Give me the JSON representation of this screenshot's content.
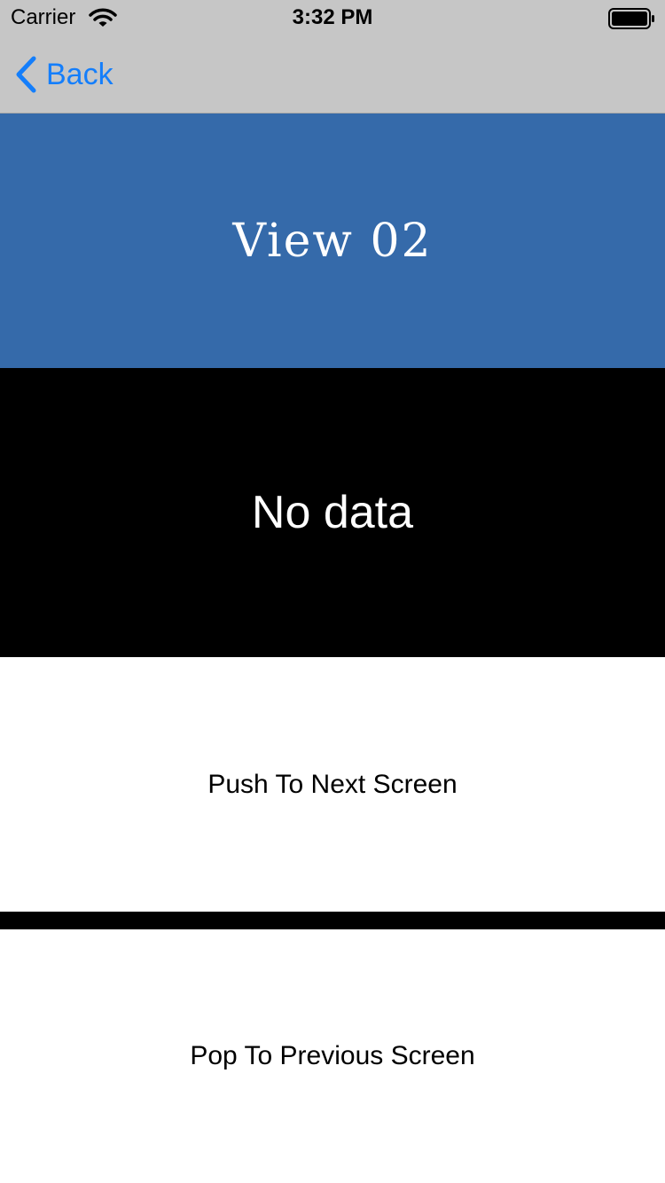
{
  "status_bar": {
    "carrier": "Carrier",
    "time": "3:32 PM",
    "icons": [
      "wifi-icon",
      "battery-icon"
    ]
  },
  "nav_bar": {
    "back_label": "Back",
    "back_icon": "chevron-left-icon",
    "tint_color": "#147efb"
  },
  "title_panel": {
    "title": "View 02",
    "background_color": "#356aaa"
  },
  "data_panel": {
    "text": "No data",
    "background_color": "#000000"
  },
  "buttons": {
    "push_label": "Push To Next Screen",
    "pop_label": "Pop To Previous Screen"
  }
}
